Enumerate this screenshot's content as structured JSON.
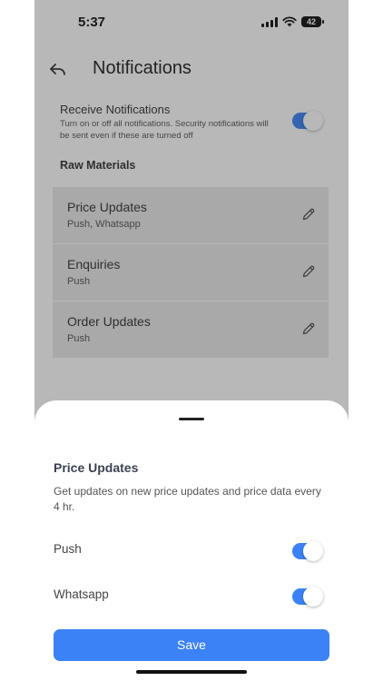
{
  "status_bar": {
    "time": "5:37",
    "battery": "42"
  },
  "header": {
    "title": "Notifications",
    "back_icon": "back-arrow-icon"
  },
  "receive": {
    "label": "Receive Notifications",
    "description": "Turn on or off all notifications. Security notifications will be sent even if these are turned off",
    "enabled": true
  },
  "raw_materials": {
    "title": "Raw Materials",
    "items": [
      {
        "title": "Price Updates",
        "channels": "Push, Whatsapp"
      },
      {
        "title": "Enquiries",
        "channels": "Push"
      },
      {
        "title": "Order Updates",
        "channels": "Push"
      }
    ]
  },
  "sheet": {
    "title": "Price Updates",
    "description": "Get updates on new price updates and price data every 4 hr.",
    "options": [
      {
        "label": "Push",
        "enabled": true
      },
      {
        "label": "Whatsapp",
        "enabled": true
      }
    ],
    "save_label": "Save"
  },
  "colors": {
    "accent": "#3b82f6",
    "card": "#e9e9e9"
  }
}
